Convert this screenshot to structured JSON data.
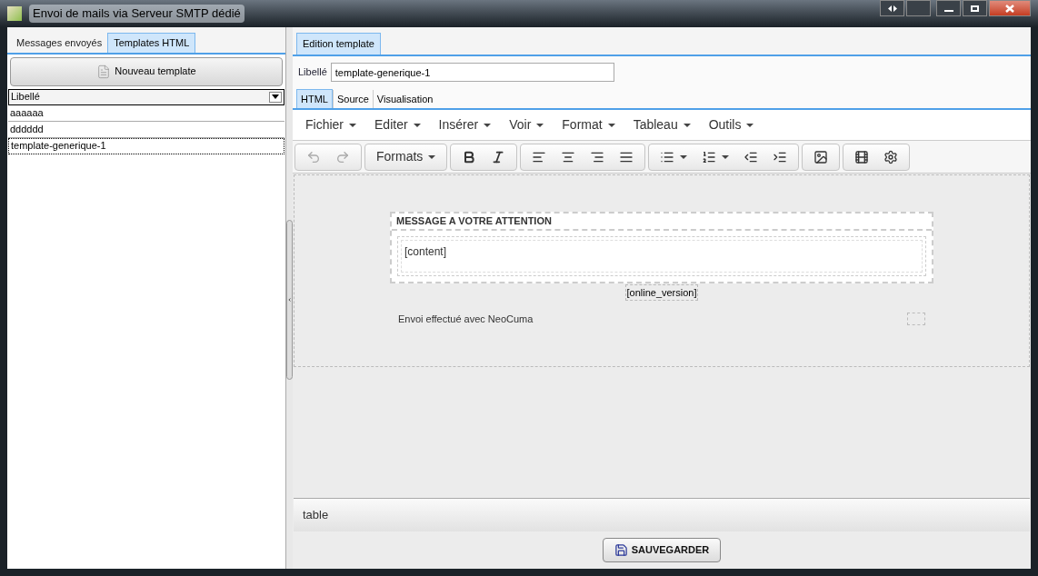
{
  "window": {
    "title": "Envoi de mails via Serveur SMTP dédié"
  },
  "left_tabs": [
    {
      "label": "Messages envoyés",
      "selected": false
    },
    {
      "label": "Templates HTML",
      "selected": true
    }
  ],
  "new_button": "Nouveau template",
  "list": {
    "column": "Libellé",
    "rows": [
      {
        "label": "aaaaaa",
        "selected": false
      },
      {
        "label": "dddddd",
        "selected": false
      },
      {
        "label": "template-generique-1",
        "selected": true
      }
    ]
  },
  "right_tabs": [
    {
      "label": "Edition template",
      "selected": true
    }
  ],
  "libelle": {
    "label": "Libellé",
    "value": "template-generique-1"
  },
  "editor_tabs": [
    {
      "label": "HTML",
      "selected": true
    },
    {
      "label": "Source",
      "selected": false
    },
    {
      "label": "Visualisation",
      "selected": false
    }
  ],
  "menu": [
    "Fichier",
    "Editer",
    "Insérer",
    "Voir",
    "Format",
    "Tableau",
    "Outils"
  ],
  "toolbar": {
    "undo_disabled": true,
    "redo_disabled": true,
    "formats": "Formats"
  },
  "document": {
    "heading": "MESSAGE A VOTRE ATTENTION",
    "content": "[content]",
    "online_version": "[online_version]",
    "footer": "Envoi effectué avec NeoCuma"
  },
  "status_path": "table",
  "save_button": "SAUVEGARDER"
}
